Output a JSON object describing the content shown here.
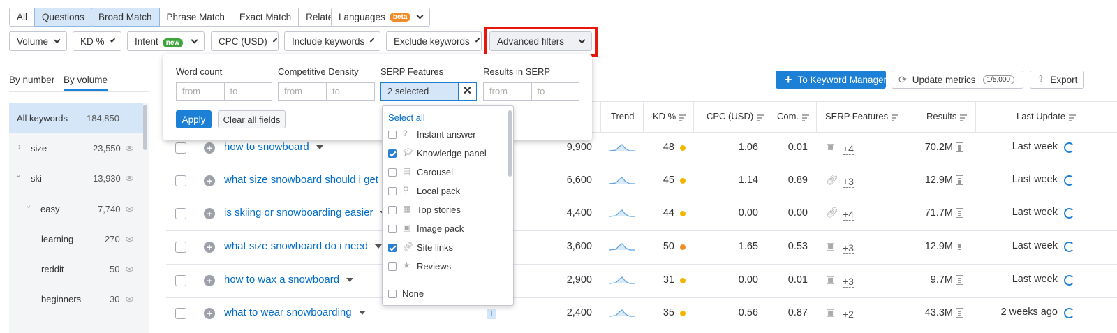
{
  "tabs_scope": {
    "all": "All",
    "questions": "Questions"
  },
  "tabs_match": [
    "Broad Match",
    "Phrase Match",
    "Exact Match",
    "Related"
  ],
  "languages": {
    "label": "Languages",
    "badge": "beta"
  },
  "filters": {
    "volume": "Volume",
    "kd": "KD %",
    "intent": "Intent",
    "intent_badge": "new",
    "cpc": "CPC (USD)",
    "include": "Include keywords",
    "exclude": "Exclude keywords",
    "advanced": "Advanced filters"
  },
  "view_toggle": {
    "by_number": "By number",
    "by_volume": "By volume"
  },
  "sidebar": [
    {
      "label": "All keywords",
      "count": "184,850"
    },
    {
      "label": "size",
      "count": "23,550"
    },
    {
      "label": "ski",
      "count": "13,930"
    },
    {
      "label": "easy",
      "count": "7,740"
    },
    {
      "label": "learning",
      "count": "270"
    },
    {
      "label": "reddit",
      "count": "50"
    },
    {
      "label": "beginners",
      "count": "30"
    }
  ],
  "advanced_panel": {
    "word_count": "Word count",
    "comp_density": "Competitive Density",
    "serp_features": "SERP Features",
    "results_in_serp": "Results in SERP",
    "from": "from",
    "to": "to",
    "selected": "2 selected",
    "apply": "Apply",
    "clear": "Clear all fields"
  },
  "serp_dropdown": {
    "select_all": "Select all",
    "items": [
      {
        "label": "Instant answer",
        "checked": false,
        "icon": "question-icon"
      },
      {
        "label": "Knowledge panel",
        "checked": true,
        "icon": "graduation-cap-icon"
      },
      {
        "label": "Carousel",
        "checked": false,
        "icon": "carousel-icon"
      },
      {
        "label": "Local pack",
        "checked": false,
        "icon": "pin-icon"
      },
      {
        "label": "Top stories",
        "checked": false,
        "icon": "news-icon"
      },
      {
        "label": "Image pack",
        "checked": false,
        "icon": "image-icon"
      },
      {
        "label": "Site links",
        "checked": true,
        "icon": "link-icon"
      },
      {
        "label": "Reviews",
        "checked": false,
        "icon": "star-icon"
      }
    ],
    "none": "None"
  },
  "actions": {
    "keyword_manager": "To Keyword Manager",
    "update_metrics": "Update metrics",
    "update_count": "1/5,000",
    "export": "Export"
  },
  "columns": {
    "trend": "Trend",
    "kd": "KD %",
    "cpc": "CPC (USD)",
    "com": "Com.",
    "serp": "SERP Features",
    "results": "Results",
    "last_update": "Last Update"
  },
  "rows": [
    {
      "keyword": "how to snowboard",
      "volume": "9,900",
      "kd": "48",
      "kd_color": "#f2b600",
      "cpc": "1.06",
      "com": "0.01",
      "serp_icon": "image-icon",
      "serp_more": "+4",
      "results": "70.2M",
      "updated": "Last week"
    },
    {
      "keyword": "what size snowboard should i get",
      "volume": "6,600",
      "kd": "45",
      "kd_color": "#f2b600",
      "cpc": "1.14",
      "com": "0.89",
      "serp_icon": "link-icon",
      "serp_more": "+3",
      "results": "12.9M",
      "updated": "Last week"
    },
    {
      "keyword": "is skiing or snowboarding easier",
      "volume": "4,400",
      "kd": "44",
      "kd_color": "#f2b600",
      "cpc": "0.00",
      "com": "0.00",
      "serp_icon": "link-icon",
      "serp_more": "+4",
      "results": "71.7M",
      "updated": "Last week"
    },
    {
      "keyword": "what size snowboard do i need",
      "volume": "3,600",
      "kd": "50",
      "kd_color": "#f28c28",
      "cpc": "1.65",
      "com": "0.53",
      "serp_icon": "image-icon",
      "serp_more": "+3",
      "results": "12.9M",
      "updated": "Last week"
    },
    {
      "keyword": "how to wax a snowboard",
      "volume": "2,900",
      "kd": "31",
      "kd_color": "#f2b600",
      "cpc": "0.00",
      "com": "0.01",
      "serp_icon": "image-icon",
      "serp_more": "+3",
      "results": "9.7M",
      "updated": "Last week"
    },
    {
      "keyword": "what to wear snowboarding",
      "volume": "2,400",
      "kd": "35",
      "kd_color": "#f2b600",
      "cpc": "0.56",
      "com": "0.87",
      "serp_icon": "image-icon",
      "serp_more": "+2",
      "results": "43.3M",
      "updated": "2 weeks ago",
      "intent": "I"
    }
  ],
  "colors": {
    "accent": "#1b80d6",
    "highlight": "#e8170e",
    "selected_bg": "#d4e6f7"
  }
}
